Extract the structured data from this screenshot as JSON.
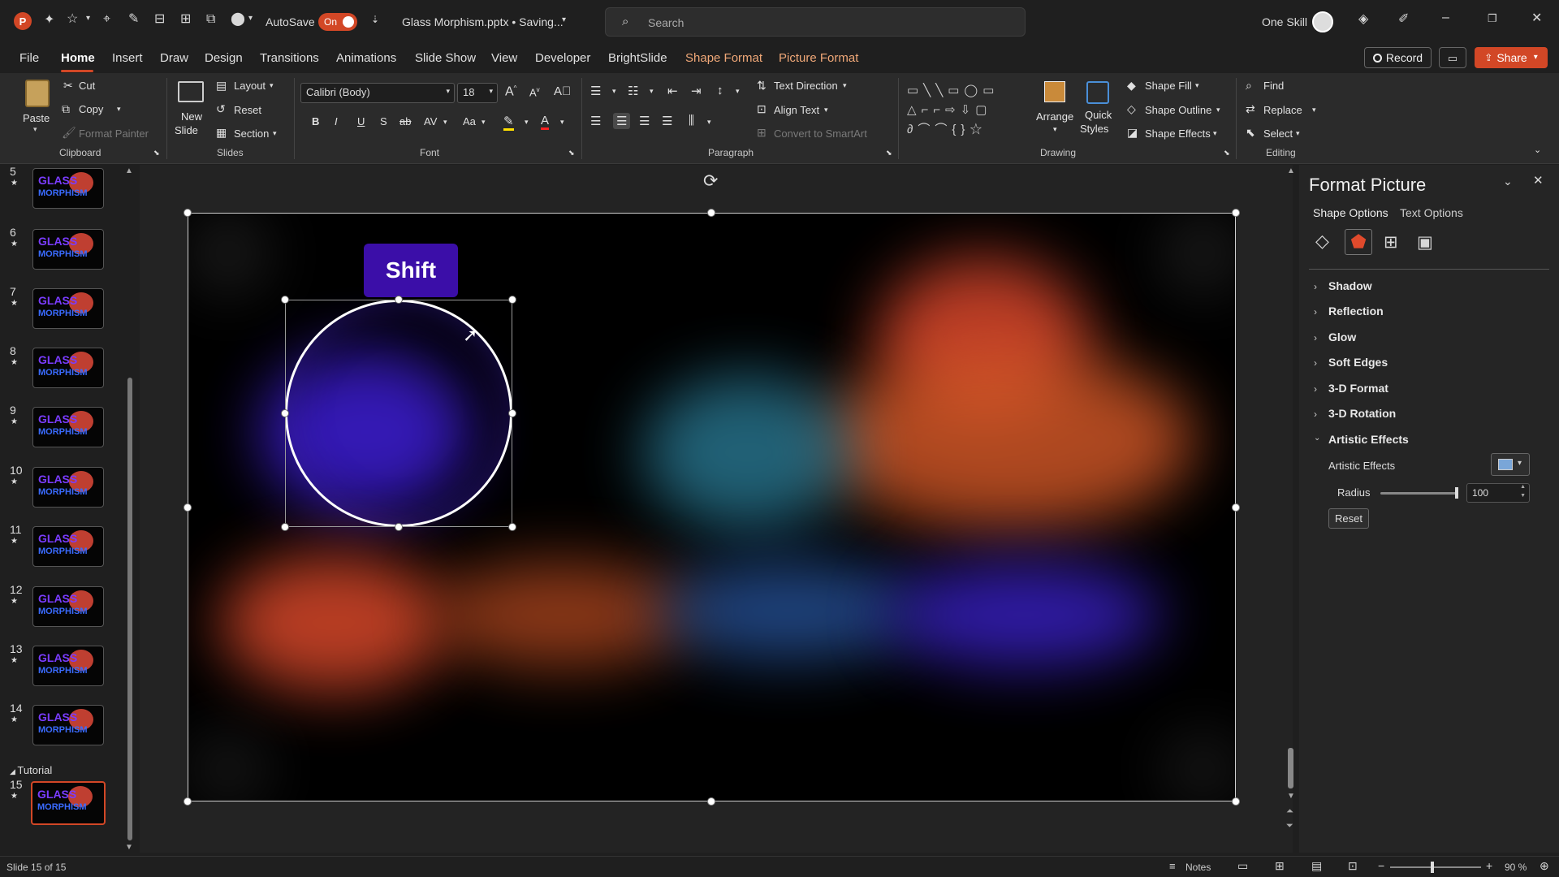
{
  "titlebar": {
    "autosave_label": "AutoSave",
    "autosave_state": "On",
    "doc_title": "Glass Morphism.pptx • Saving...",
    "search_placeholder": "Search",
    "user_name": "One Skill"
  },
  "menu": {
    "file": "File",
    "home": "Home",
    "insert": "Insert",
    "draw": "Draw",
    "design": "Design",
    "transitions": "Transitions",
    "animations": "Animations",
    "slideshow": "Slide Show",
    "view": "View",
    "developer": "Developer",
    "brightslide": "BrightSlide",
    "shape_format": "Shape Format",
    "picture_format": "Picture Format",
    "record": "Record",
    "share": "Share"
  },
  "ribbon": {
    "clipboard": {
      "paste": "Paste",
      "cut": "Cut",
      "copy": "Copy",
      "format_painter": "Format Painter",
      "group": "Clipboard"
    },
    "slides": {
      "new_slide_1": "New",
      "new_slide_2": "Slide",
      "layout": "Layout",
      "reset": "Reset",
      "section": "Section",
      "group": "Slides"
    },
    "font": {
      "name": "Calibri (Body)",
      "size": "18",
      "bold": "B",
      "italic": "I",
      "underline": "U",
      "shadow": "S",
      "strike": "ab",
      "spacing": "AV",
      "case": "Aa",
      "group": "Font"
    },
    "paragraph": {
      "text_direction": "Text Direction",
      "align_text": "Align Text",
      "smartart": "Convert to SmartArt",
      "group": "Paragraph"
    },
    "drawing": {
      "arrange": "Arrange",
      "quick_styles_1": "Quick",
      "quick_styles_2": "Styles",
      "shape_fill": "Shape Fill",
      "shape_outline": "Shape Outline",
      "shape_effects": "Shape Effects",
      "group": "Drawing"
    },
    "editing": {
      "find": "Find",
      "replace": "Replace",
      "select": "Select",
      "group": "Editing"
    }
  },
  "slides": [
    {
      "num": "5",
      "t1": "GLASS",
      "t2": "MORPHISM"
    },
    {
      "num": "6",
      "t1": "GLASS",
      "t2": "MORPHISM"
    },
    {
      "num": "7",
      "t1": "GLASS",
      "t2": "MORPHISM"
    },
    {
      "num": "8",
      "t1": "GLASS",
      "t2": "MORPHISM"
    },
    {
      "num": "9",
      "t1": "GLASS",
      "t2": "MORPHISM"
    },
    {
      "num": "10",
      "t1": "GLASS",
      "t2": "MORPHISM"
    },
    {
      "num": "11",
      "t1": "GLASS",
      "t2": "MORPHISM"
    },
    {
      "num": "12",
      "t1": "GLASS",
      "t2": "MORPHISM"
    },
    {
      "num": "13",
      "t1": "GLASS",
      "t2": "MORPHISM"
    },
    {
      "num": "14",
      "t1": "GLASS",
      "t2": "MORPHISM"
    },
    {
      "num": "15",
      "t1": "GLASS",
      "t2": "MORPHISM"
    }
  ],
  "section": {
    "name": "Tutorial"
  },
  "canvas": {
    "key_hint": "Shift"
  },
  "format_pane": {
    "title": "Format Picture",
    "tab_shape": "Shape Options",
    "tab_text": "Text Options",
    "sections": [
      "Shadow",
      "Reflection",
      "Glow",
      "Soft Edges",
      "3-D Format",
      "3-D Rotation",
      "Artistic Effects"
    ],
    "artistic_effects_label": "Artistic Effects",
    "radius_label": "Radius",
    "radius_value": "100",
    "radius_fraction": 1.0,
    "reset": "Reset"
  },
  "status": {
    "slide_info": "Slide 15 of 15",
    "notes": "Notes",
    "zoom": "90 %"
  },
  "colors": {
    "accent": "#d24726",
    "selection": "#ffffff",
    "shift_badge": "#3b0ea8"
  }
}
